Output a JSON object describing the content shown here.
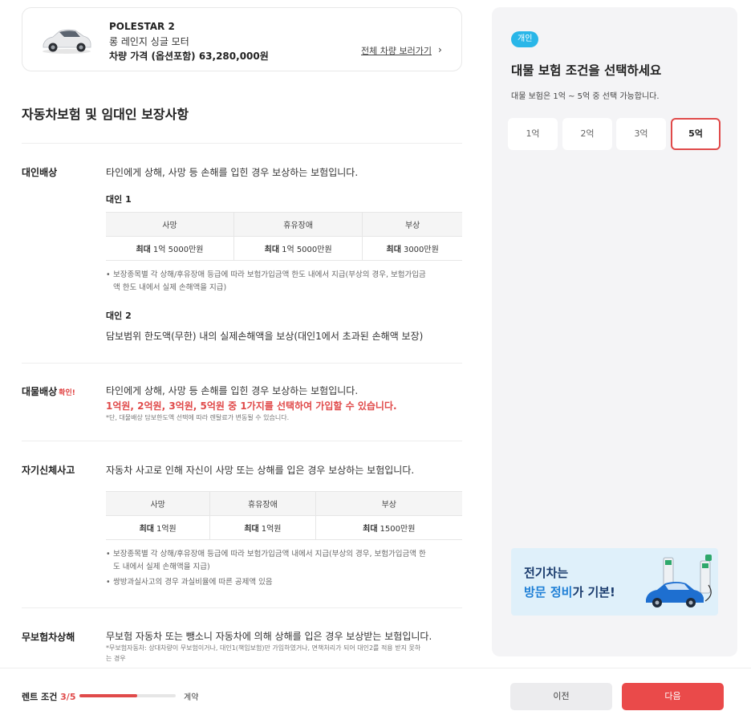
{
  "car": {
    "name": "POLESTAR 2",
    "trim": "롱 레인지 싱글 모터",
    "price": "차량 가격 (옵션포함) 63,280,000원",
    "view_all": "전체 차량 보러가기",
    "chevron": "›"
  },
  "section_title": "자동차보험 및 임대인 보장사항",
  "bodily": {
    "label": "대인배상",
    "desc": "타인에게 상해, 사망 등 손해를 입힌 경우 보상하는 보험입니다.",
    "sub1": "대인 1",
    "headers": [
      "사망",
      "휴유장애",
      "부상"
    ],
    "max_word": "최대",
    "values": [
      "1억 5000만원",
      "1억 5000만원",
      "3000만원"
    ],
    "note_l1": "보장종목별 각 상해/후유장애 등급에 따라 보험가입금액 한도 내에서 지급(부상의 경우, 보험가입금",
    "note_l2": "액 한도 내에서 실제 손해액을 지급)",
    "sub2": "대인 2",
    "desc2": "담보범위 한도액(무한) 내의 실제손해액을 보상(대인1에서 초과된 손해액 보장)"
  },
  "property": {
    "label": "대물배상",
    "confirm": "확인!",
    "desc": "타인에게 상해, 사망 등 손해를 입힌 경우 보상하는 보험입니다.",
    "emphasis": "1억원, 2억원, 3억원, 5억원 중 1가지를 선택하여 가입할 수 있습니다.",
    "footnote": "*단, 대물배상 담보한도액 선택에 따라 렌탈료가 변동될 수 있습니다."
  },
  "self_injury": {
    "label": "자기신체사고",
    "desc": "자동차 사고로 인해 자신이 사망 또는 상해를 입은 경우 보상하는 보험입니다.",
    "headers": [
      "사망",
      "휴유장애",
      "부상"
    ],
    "max_word": "최대",
    "values": [
      "1억원",
      "1억원",
      "1500만원"
    ],
    "note1_l1": "보장종목별 각 상해/후유장애 등급에 따라 보험가입금액 내에서 지급(부상의 경우, 보험가입금액 한",
    "note1_l2": "도 내에서 실제 손해액을 지급)",
    "note2": "쌍방과실사고의 경우 과실비율에 따른 공제액 있음"
  },
  "uninsured": {
    "label": "무보험차상해",
    "desc": "무보험 자동차 또는 뺑소니 자동차에 의해 상해를 입은 경우 보상받는 보험입니다.",
    "note_l1": "*무보험자동차: 상대차량이 무보험이거나, 대인1(책임보험)만 가입하였거나, 면책처리가 되어 대인2를 적용 받지 못하",
    "note_l2": "는 경우"
  },
  "panel": {
    "tag": "개인",
    "title": "대물 보험 조건을 선택하세요",
    "subtitle": "대물 보험은 1억 ~ 5억 중 선택 가능합니다.",
    "options": [
      "1억",
      "2억",
      "3억",
      "5억"
    ],
    "selected_option": "5억",
    "banner_line1": "전기차는",
    "banner_line2_hl": "방문 정비",
    "banner_line2_rest": "가 기본!"
  },
  "footer": {
    "step_label": "렌트 조건",
    "step_count": "3/5",
    "progress": 0.6,
    "next_step": "계약",
    "prev_button": "이전",
    "next_button": "다음"
  },
  "colors": {
    "accent_red": "#e04a4a",
    "tag_blue": "#29b6e8",
    "banner_bg": "#dff0fa",
    "banner_text": "#1a3b6d"
  },
  "icons": {
    "car_thumbnail": "car-image",
    "chevron": "chevron-right-icon",
    "banner": "ev-charging-illustration"
  }
}
